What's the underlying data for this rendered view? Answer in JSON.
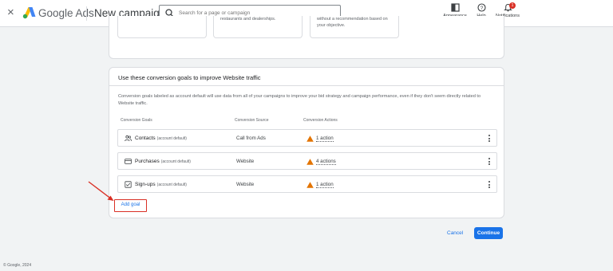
{
  "header": {
    "close_glyph": "×",
    "brand": "Google Ads",
    "page_title": "New campaign",
    "search_placeholder": "Search for a page or campaign",
    "appearance_label": "Appearance",
    "help_label": "Help",
    "notifications_label": "Notifications",
    "notifications_count": "1"
  },
  "top_card": {
    "option_2_text": "restaurants and dealerships.",
    "option_3_text_line1": "without a recommendation based on",
    "option_3_text_line2": "your objective."
  },
  "goals_card": {
    "title": "Use these conversion goals to improve Website traffic",
    "description": "Conversion goals labeled as account default will use data from all of your campaigns to improve your bid strategy and campaign performance, even if they don't seem directly related to Website traffic.",
    "columns": [
      "Conversion Goals",
      "Conversion Source",
      "Conversion Actions"
    ],
    "rows": [
      {
        "name": "Contacts",
        "sub": "(account default)",
        "source": "Call from Ads",
        "action": "1 action",
        "icon": "contacts-icon"
      },
      {
        "name": "Purchases",
        "sub": "(account default)",
        "source": "Website",
        "action": "4 actions",
        "icon": "credit-card-icon"
      },
      {
        "name": "Sign-ups",
        "sub": "(account default)",
        "source": "Website",
        "action": "1 action",
        "icon": "checkbox-icon"
      }
    ],
    "add_goal_label": "Add goal"
  },
  "actions": {
    "cancel_label": "Cancel",
    "continue_label": "Continue"
  },
  "footer": {
    "copyright": "© Google, 2024"
  },
  "colors": {
    "accent": "#1a73e8",
    "highlight": "#d93025",
    "warning": "#e37400"
  }
}
